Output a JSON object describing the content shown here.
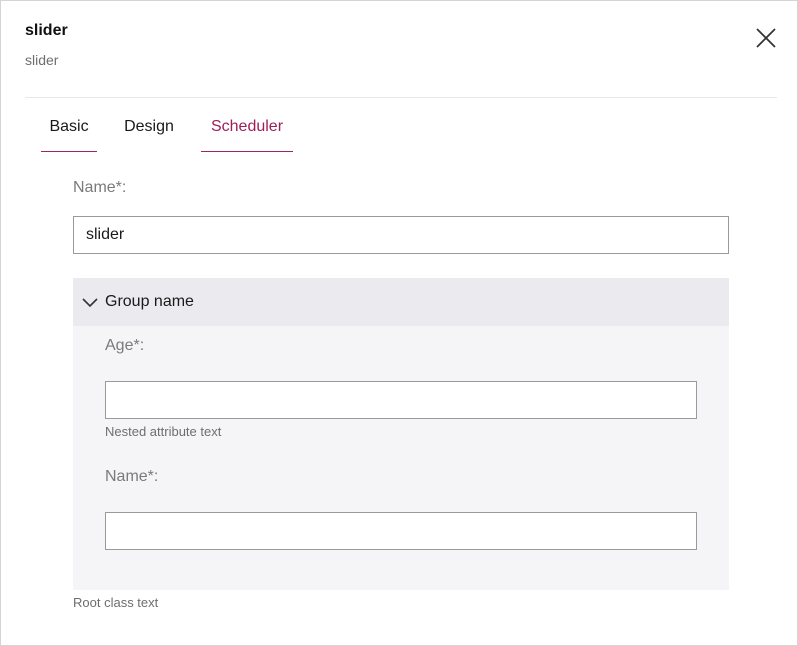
{
  "dialog": {
    "title": "slider",
    "subtitle": "slider"
  },
  "tabs": [
    {
      "label": "Basic"
    },
    {
      "label": "Design"
    },
    {
      "label": "Scheduler",
      "active": true
    }
  ],
  "form": {
    "name_label": "Name*:",
    "name_value": "slider",
    "group": {
      "title": "Group name",
      "age_label": "Age*:",
      "age_value": "",
      "age_hint": "Nested attribute text",
      "name_label": "Name*:",
      "name_value": ""
    },
    "root_hint": "Root class text"
  },
  "colors": {
    "accent": "#9c1f5c",
    "group_bg": "#f5f5f7",
    "group_header_bg": "#ebebef"
  }
}
